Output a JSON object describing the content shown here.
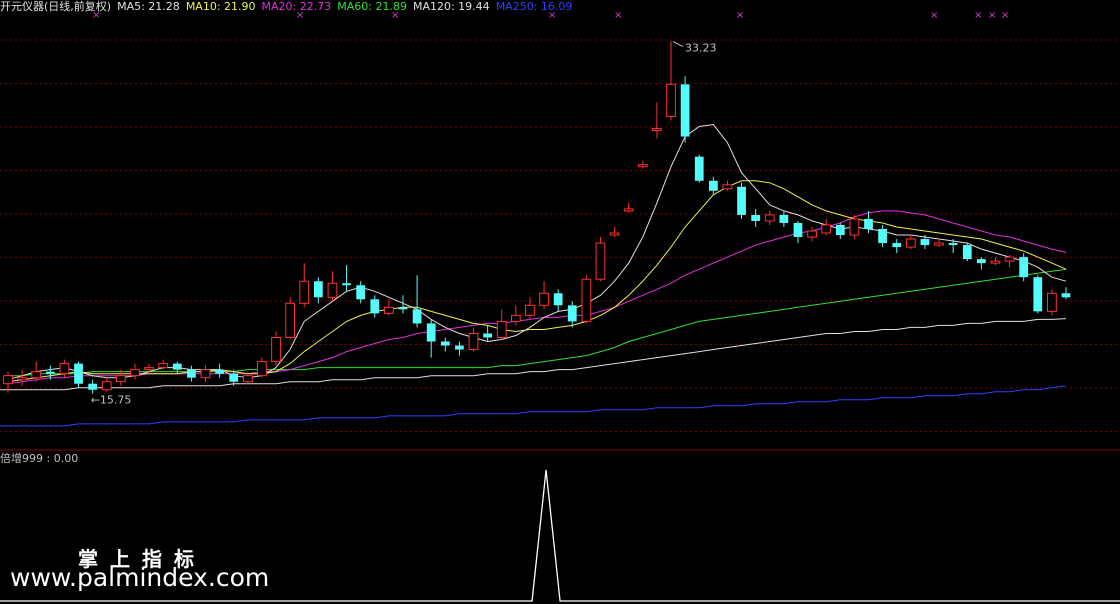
{
  "legend": {
    "title": "开元仪器(日线,前复权)",
    "items": [
      {
        "name": "MA5",
        "value": "21.28",
        "color": "#e0e0e0"
      },
      {
        "name": "MA10",
        "value": "21.90",
        "color": "#f0f050"
      },
      {
        "name": "MA20",
        "value": "22.73",
        "color": "#e030e0"
      },
      {
        "name": "MA60",
        "value": "21.89",
        "color": "#30e030"
      },
      {
        "name": "MA120",
        "value": "19.44",
        "color": "#e0e0e0"
      },
      {
        "name": "MA250",
        "value": "16.09",
        "color": "#3040ff"
      }
    ],
    "title_color": "#e0e0e0"
  },
  "sub_indicator": {
    "label": "倍增999 : 0.00"
  },
  "watermark": {
    "cn": "掌上指标",
    "url": "www.palmindex.com"
  },
  "colors": {
    "up": "#ff3030",
    "down": "#54fcfc",
    "grid": "#800000",
    "ma5": "#e0e0e0",
    "ma10": "#f0f050",
    "ma20": "#e030e0",
    "ma60": "#30e030",
    "ma120": "#e0e0e0",
    "ma250": "#3040ff",
    "signal": "#ffffff",
    "marker": "#d040d0"
  },
  "chart_data": {
    "type": "candlestick",
    "annotations": [
      {
        "text": "33.23",
        "kind": "high"
      },
      {
        "text": "15.75",
        "kind": "low"
      }
    ],
    "ylim": [
      13.0,
      34.5
    ],
    "grid": true,
    "candles": [
      [
        16.2,
        16.6,
        16.8,
        15.75
      ],
      [
        16.4,
        16.5,
        16.9,
        16.1
      ],
      [
        16.5,
        16.8,
        17.3,
        16.3
      ],
      [
        16.8,
        16.7,
        17.1,
        16.4
      ],
      [
        16.7,
        17.2,
        17.4,
        16.5
      ],
      [
        17.2,
        16.2,
        17.3,
        16.0
      ],
      [
        16.2,
        15.9,
        16.4,
        15.7
      ],
      [
        15.9,
        16.3,
        16.5,
        15.8
      ],
      [
        16.3,
        16.6,
        16.9,
        16.1
      ],
      [
        16.6,
        16.9,
        17.2,
        16.4
      ],
      [
        16.9,
        17.0,
        17.2,
        16.7
      ],
      [
        17.0,
        17.2,
        17.4,
        16.9
      ],
      [
        17.2,
        16.9,
        17.3,
        16.7
      ],
      [
        16.9,
        16.5,
        17.1,
        16.3
      ],
      [
        16.5,
        16.9,
        17.1,
        16.3
      ],
      [
        16.9,
        16.7,
        17.2,
        16.5
      ],
      [
        16.7,
        16.3,
        16.9,
        16.1
      ],
      [
        16.3,
        16.6,
        16.8,
        16.2
      ],
      [
        16.6,
        17.3,
        17.5,
        16.5
      ],
      [
        17.3,
        18.5,
        18.8,
        17.1
      ],
      [
        18.5,
        20.2,
        20.5,
        18.4
      ],
      [
        20.2,
        21.3,
        22.2,
        20.0
      ],
      [
        21.3,
        20.5,
        21.5,
        20.2
      ],
      [
        20.5,
        21.2,
        21.8,
        20.3
      ],
      [
        21.2,
        21.1,
        22.1,
        20.8
      ],
      [
        21.1,
        20.4,
        21.3,
        20.2
      ],
      [
        20.4,
        19.7,
        20.6,
        19.5
      ],
      [
        19.7,
        20.0,
        20.4,
        19.6
      ],
      [
        20.0,
        19.9,
        20.6,
        19.7
      ],
      [
        19.9,
        19.2,
        21.6,
        19.0
      ],
      [
        19.2,
        18.3,
        19.4,
        17.5
      ],
      [
        18.3,
        18.1,
        18.5,
        17.8
      ],
      [
        18.1,
        17.9,
        18.3,
        17.6
      ],
      [
        17.9,
        18.7,
        19.0,
        17.8
      ],
      [
        18.7,
        18.5,
        19.1,
        18.3
      ],
      [
        18.5,
        19.3,
        19.9,
        18.4
      ],
      [
        19.3,
        19.6,
        20.1,
        19.1
      ],
      [
        19.6,
        20.1,
        20.5,
        19.4
      ],
      [
        20.1,
        20.7,
        21.3,
        19.9
      ],
      [
        20.7,
        20.1,
        20.9,
        19.8
      ],
      [
        20.1,
        19.3,
        20.3,
        19.0
      ],
      [
        19.3,
        21.4,
        21.6,
        19.2
      ],
      [
        21.4,
        23.2,
        23.5,
        21.3
      ],
      [
        23.6,
        23.7,
        24.0,
        23.5
      ],
      [
        24.8,
        24.9,
        25.2,
        24.7
      ],
      [
        27.0,
        27.1,
        27.3,
        26.9
      ],
      [
        28.8,
        28.9,
        30.2,
        28.4
      ],
      [
        29.5,
        31.1,
        33.23,
        29.3
      ],
      [
        31.1,
        28.5,
        31.5,
        28.2
      ],
      [
        27.5,
        26.3,
        27.6,
        26.2
      ],
      [
        26.3,
        25.8,
        26.5,
        25.6
      ],
      [
        25.9,
        26.1,
        26.3,
        25.8
      ],
      [
        26.0,
        24.6,
        26.2,
        24.4
      ],
      [
        24.6,
        24.3,
        24.9,
        24.0
      ],
      [
        24.3,
        24.6,
        24.8,
        24.1
      ],
      [
        24.6,
        24.2,
        24.8,
        24.0
      ],
      [
        24.2,
        23.5,
        24.3,
        23.2
      ],
      [
        23.5,
        23.8,
        24.0,
        23.3
      ],
      [
        23.7,
        24.1,
        24.4,
        23.6
      ],
      [
        24.1,
        23.6,
        24.2,
        23.4
      ],
      [
        23.6,
        24.4,
        24.6,
        23.4
      ],
      [
        24.4,
        23.9,
        24.8,
        23.7
      ],
      [
        23.9,
        23.2,
        24.1,
        23.0
      ],
      [
        23.2,
        23.0,
        23.4,
        22.7
      ],
      [
        23.0,
        23.4,
        23.6,
        22.9
      ],
      [
        23.4,
        23.1,
        23.6,
        22.9
      ],
      [
        23.1,
        23.2,
        23.4,
        23.0
      ],
      [
        23.2,
        23.1,
        23.4,
        22.7
      ],
      [
        23.1,
        22.4,
        23.2,
        22.3
      ],
      [
        22.4,
        22.2,
        22.5,
        21.9
      ],
      [
        22.2,
        22.3,
        22.5,
        22.1
      ],
      [
        22.3,
        22.5,
        22.6,
        22.0
      ],
      [
        22.5,
        21.5,
        22.7,
        21.3
      ],
      [
        21.5,
        19.8,
        21.6,
        19.7
      ],
      [
        19.8,
        20.7,
        20.9,
        19.6
      ],
      [
        20.7,
        20.5,
        21.0,
        20.4
      ]
    ],
    "ma5": [
      16.4,
      16.6,
      16.8,
      16.9,
      17.0,
      16.8,
      16.6,
      16.5,
      16.5,
      16.6,
      16.8,
      17.0,
      17.0,
      16.9,
      16.9,
      16.9,
      16.6,
      16.5,
      16.6,
      17.0,
      17.9,
      19.3,
      19.8,
      20.3,
      20.8,
      21.0,
      20.8,
      20.5,
      20.2,
      19.9,
      19.4,
      19.0,
      18.7,
      18.5,
      18.3,
      18.4,
      18.6,
      19.0,
      19.5,
      19.8,
      19.9,
      20.2,
      20.6,
      21.3,
      22.2,
      23.5,
      25.2,
      27.0,
      28.5,
      29.0,
      29.1,
      28.2,
      26.7,
      25.9,
      25.1,
      24.8,
      24.6,
      24.3,
      24.1,
      23.9,
      24.0,
      23.9,
      23.8,
      23.6,
      23.6,
      23.5,
      23.4,
      23.3,
      23.2,
      22.9,
      22.7,
      22.5,
      22.3,
      22.0,
      21.5,
      21.3
    ],
    "ma10": [
      16.3,
      16.4,
      16.5,
      16.6,
      16.7,
      16.8,
      16.7,
      16.7,
      16.7,
      16.7,
      16.7,
      16.7,
      16.7,
      16.8,
      16.8,
      16.9,
      16.8,
      16.7,
      16.7,
      16.8,
      17.2,
      17.8,
      18.3,
      18.8,
      19.3,
      19.6,
      19.8,
      19.9,
      20.0,
      20.0,
      19.8,
      19.6,
      19.4,
      19.2,
      19.1,
      18.9,
      18.8,
      18.9,
      18.9,
      19.0,
      19.1,
      19.3,
      19.6,
      20.0,
      20.6,
      21.3,
      22.1,
      23.0,
      24.0,
      24.8,
      25.6,
      26.0,
      26.3,
      26.3,
      26.2,
      25.9,
      25.5,
      25.1,
      24.8,
      24.6,
      24.4,
      24.3,
      24.2,
      24.0,
      23.9,
      23.8,
      23.7,
      23.6,
      23.5,
      23.4,
      23.2,
      23.0,
      22.8,
      22.5,
      22.2,
      21.9
    ],
    "ma20": [
      16.2,
      16.3,
      16.4,
      16.5,
      16.5,
      16.6,
      16.6,
      16.6,
      16.6,
      16.6,
      16.7,
      16.7,
      16.7,
      16.7,
      16.7,
      16.7,
      16.7,
      16.7,
      16.8,
      16.8,
      16.9,
      17.1,
      17.3,
      17.5,
      17.8,
      18.0,
      18.2,
      18.4,
      18.5,
      18.7,
      18.8,
      18.9,
      19.0,
      19.1,
      19.2,
      19.2,
      19.3,
      19.4,
      19.5,
      19.5,
      19.6,
      19.6,
      19.8,
      20.0,
      20.3,
      20.6,
      20.9,
      21.2,
      21.6,
      21.9,
      22.2,
      22.5,
      22.8,
      23.1,
      23.3,
      23.5,
      23.7,
      23.8,
      24.0,
      24.2,
      24.5,
      24.7,
      24.8,
      24.8,
      24.7,
      24.6,
      24.4,
      24.2,
      24.0,
      23.8,
      23.6,
      23.5,
      23.3,
      23.1,
      22.9,
      22.73
    ],
    "ma60": [
      16.6,
      16.6,
      16.7,
      16.7,
      16.7,
      16.7,
      16.8,
      16.8,
      16.8,
      16.8,
      16.8,
      16.8,
      16.8,
      16.8,
      16.8,
      16.8,
      16.8,
      16.9,
      16.9,
      16.9,
      16.9,
      16.9,
      17.0,
      17.0,
      17.0,
      17.0,
      17.0,
      17.0,
      17.0,
      17.0,
      17.0,
      17.0,
      17.0,
      17.0,
      17.0,
      17.1,
      17.1,
      17.2,
      17.3,
      17.4,
      17.5,
      17.6,
      17.8,
      18.0,
      18.3,
      18.5,
      18.7,
      18.9,
      19.1,
      19.3,
      19.4,
      19.5,
      19.6,
      19.7,
      19.8,
      19.9,
      20.0,
      20.1,
      20.2,
      20.3,
      20.4,
      20.5,
      20.6,
      20.7,
      20.8,
      20.9,
      21.0,
      21.1,
      21.2,
      21.3,
      21.4,
      21.5,
      21.6,
      21.7,
      21.8,
      21.89
    ],
    "ma120": [
      15.9,
      15.9,
      15.9,
      15.9,
      15.9,
      16.0,
      16.0,
      16.0,
      16.0,
      16.0,
      16.0,
      16.1,
      16.1,
      16.1,
      16.1,
      16.1,
      16.2,
      16.2,
      16.2,
      16.2,
      16.3,
      16.3,
      16.3,
      16.4,
      16.4,
      16.4,
      16.5,
      16.5,
      16.5,
      16.5,
      16.6,
      16.6,
      16.6,
      16.6,
      16.7,
      16.7,
      16.7,
      16.8,
      16.8,
      16.9,
      16.9,
      17.0,
      17.1,
      17.2,
      17.3,
      17.4,
      17.5,
      17.6,
      17.7,
      17.8,
      17.9,
      18.0,
      18.1,
      18.2,
      18.3,
      18.4,
      18.5,
      18.6,
      18.7,
      18.7,
      18.8,
      18.8,
      18.9,
      18.9,
      19.0,
      19.0,
      19.1,
      19.1,
      19.2,
      19.2,
      19.3,
      19.3,
      19.3,
      19.4,
      19.4,
      19.44
    ],
    "ma250": [
      14.1,
      14.1,
      14.1,
      14.1,
      14.1,
      14.2,
      14.2,
      14.2,
      14.2,
      14.2,
      14.2,
      14.3,
      14.3,
      14.3,
      14.3,
      14.3,
      14.3,
      14.4,
      14.4,
      14.4,
      14.4,
      14.4,
      14.5,
      14.5,
      14.5,
      14.5,
      14.5,
      14.6,
      14.6,
      14.6,
      14.6,
      14.6,
      14.7,
      14.7,
      14.7,
      14.7,
      14.7,
      14.8,
      14.8,
      14.8,
      14.8,
      14.8,
      14.9,
      14.9,
      14.9,
      14.9,
      15.0,
      15.0,
      15.0,
      15.0,
      15.1,
      15.1,
      15.1,
      15.2,
      15.2,
      15.2,
      15.3,
      15.3,
      15.3,
      15.4,
      15.4,
      15.4,
      15.5,
      15.5,
      15.5,
      15.6,
      15.6,
      15.6,
      15.7,
      15.7,
      15.8,
      15.8,
      15.9,
      15.9,
      16.0,
      16.09
    ],
    "signal": [
      0,
      0,
      0,
      0,
      0,
      0,
      0,
      0,
      0,
      0,
      0,
      0,
      0,
      0,
      0,
      0,
      0,
      0,
      0,
      0,
      0,
      0,
      0,
      0,
      0,
      0,
      0,
      0,
      0,
      0,
      0,
      0,
      0,
      0,
      0,
      0,
      0,
      0,
      0,
      0,
      0,
      0,
      0,
      0,
      0,
      0,
      0,
      0,
      0,
      0,
      0,
      0,
      0,
      0,
      0,
      0,
      0,
      0,
      0,
      0,
      0,
      0,
      0,
      0,
      0,
      0,
      0,
      0,
      0,
      0,
      0,
      0,
      0,
      0,
      0,
      0
    ],
    "signal_spike_index": 38,
    "signal_ylim": [
      0,
      1
    ]
  }
}
